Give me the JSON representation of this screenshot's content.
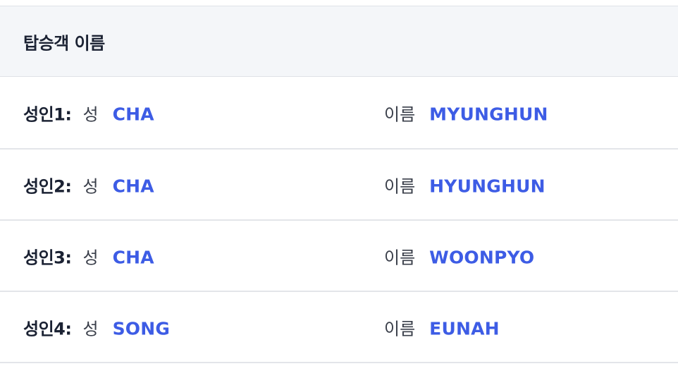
{
  "header": {
    "title": "탑승객 이름"
  },
  "passengers": [
    {
      "label": "성인1:",
      "surname_label": "성",
      "surname": "CHA",
      "given_label": "이름",
      "given": "MYUNGHUN"
    },
    {
      "label": "성인2:",
      "surname_label": "성",
      "surname": "CHA",
      "given_label": "이름",
      "given": "HYUNGHUN"
    },
    {
      "label": "성인3:",
      "surname_label": "성",
      "surname": "CHA",
      "given_label": "이름",
      "given": "WOONPYO"
    },
    {
      "label": "성인4:",
      "surname_label": "성",
      "surname": "SONG",
      "given_label": "이름",
      "given": "EUNAH"
    }
  ],
  "colors": {
    "value": "#3d5ce5",
    "header_bg": "#f4f6f9",
    "text": "#1b2233",
    "divider": "#e3e5e9"
  }
}
